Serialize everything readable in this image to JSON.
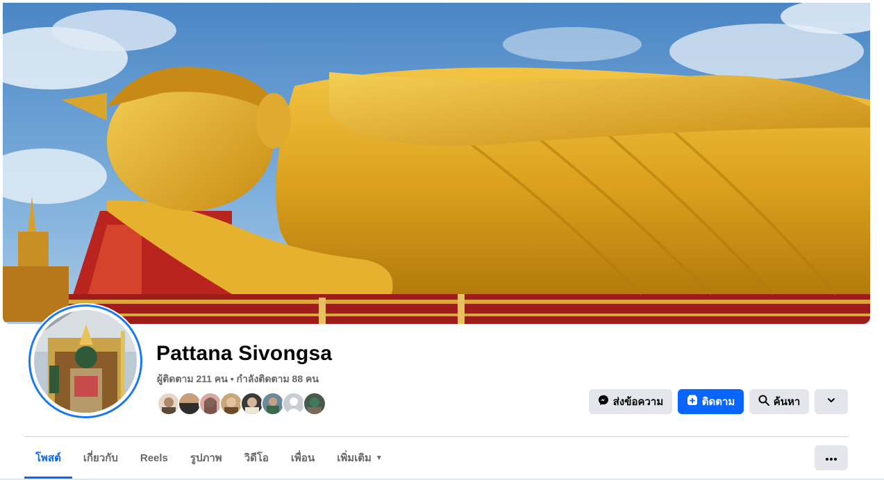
{
  "profile": {
    "name": "Pattana Sivongsa",
    "stats": "ผู้ติดตาม 211 คน • กำลังติดตาม 88 คน"
  },
  "actions": {
    "message_label": "ส่งข้อความ",
    "follow_label": "ติดตาม",
    "search_label": "ค้นหา"
  },
  "tabs": [
    {
      "label": "โพสต์",
      "active": true
    },
    {
      "label": "เกี่ยวกับ",
      "active": false
    },
    {
      "label": "Reels",
      "active": false
    },
    {
      "label": "รูปภาพ",
      "active": false
    },
    {
      "label": "วิดีโอ",
      "active": false
    },
    {
      "label": "เพื่อน",
      "active": false
    },
    {
      "label": "เพิ่มเติม",
      "active": false
    }
  ],
  "icons": {
    "message": "messenger-icon",
    "follow": "follow-plus-icon",
    "search": "search-icon",
    "dropdown": "chevron-down-icon",
    "more": "ellipsis-icon",
    "tab_more_caret": "caret-down-icon"
  },
  "colors": {
    "accent": "#0866ff",
    "button_gray": "#e4e6eb",
    "muted_text": "#65676b",
    "avatar_ring": "#1877f2"
  }
}
